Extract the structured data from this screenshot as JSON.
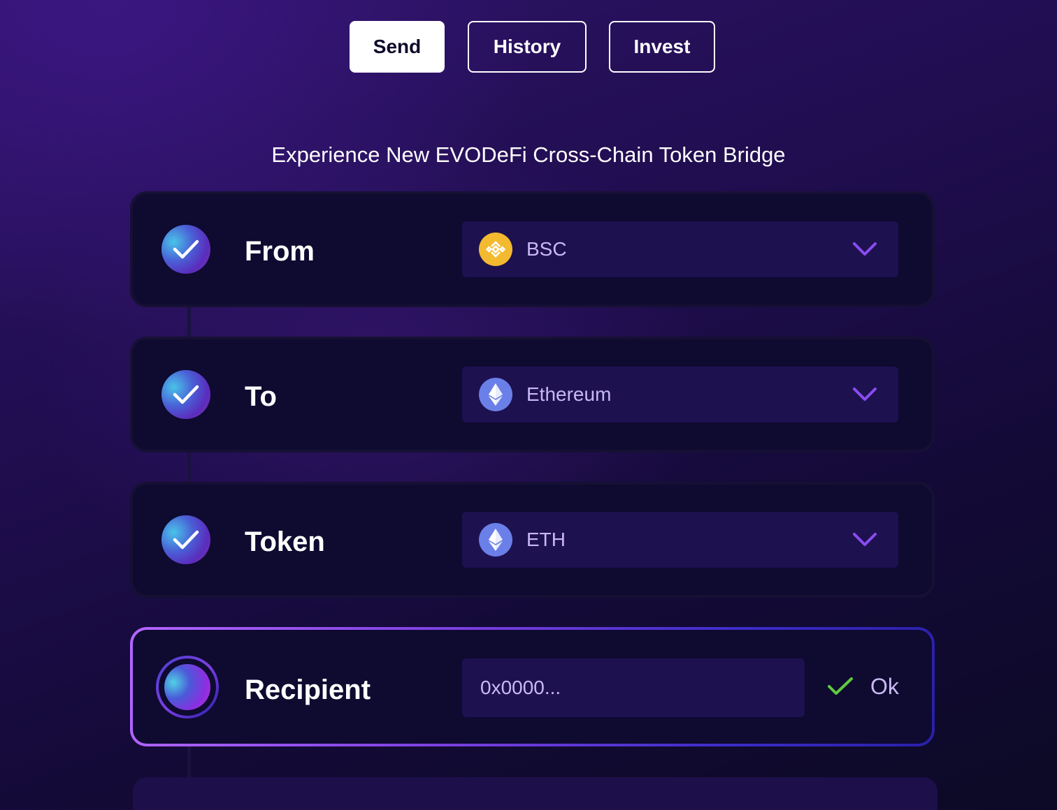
{
  "nav": {
    "tabs": [
      {
        "label": "Send",
        "active": true
      },
      {
        "label": "History",
        "active": false
      },
      {
        "label": "Invest",
        "active": false
      }
    ]
  },
  "headline": "Experience New EVODeFi Cross-Chain Token Bridge",
  "steps": [
    {
      "label": "From",
      "status": "complete",
      "value": "BSC",
      "icon": "bnb-coin-icon"
    },
    {
      "label": "To",
      "status": "complete",
      "value": "Ethereum",
      "icon": "ethereum-icon"
    },
    {
      "label": "Token",
      "status": "complete",
      "value": "ETH",
      "icon": "ethereum-icon"
    },
    {
      "label": "Recipient",
      "status": "current",
      "placeholder": "0x0000...",
      "confirm_label": "Ok"
    }
  ],
  "colors": {
    "accent": "#7b3fe0",
    "chevron": "#8a4cf0",
    "ok_check": "#5ecb3e",
    "bnb": "#f3ba2f",
    "eth": "#6b7fe8"
  }
}
